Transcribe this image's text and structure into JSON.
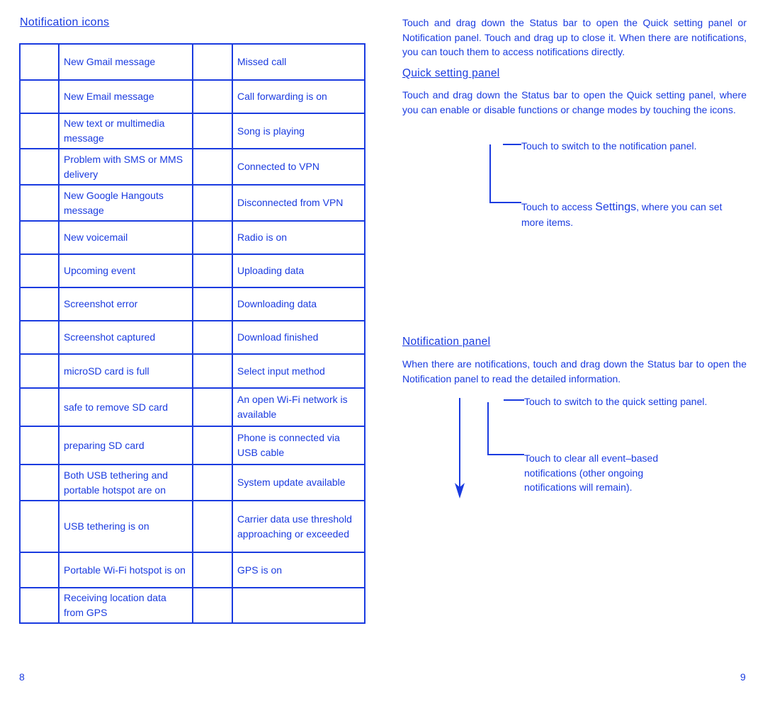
{
  "left_page": {
    "heading": "Notification icons",
    "rows": [
      {
        "left": "New Gmail message",
        "right": "Missed call"
      },
      {
        "left": "New Email message",
        "right": "Call forwarding is on"
      },
      {
        "left": "New text or multimedia message",
        "right": "Song is playing"
      },
      {
        "left": "Problem with SMS or MMS delivery",
        "right": "Connected to VPN"
      },
      {
        "left": "New Google Hangouts message",
        "right": "Disconnected from VPN"
      },
      {
        "left": "New voicemail",
        "right": "Radio is on"
      },
      {
        "left": "Upcoming event",
        "right": "Uploading data"
      },
      {
        "left": "Screenshot error",
        "right": "Downloading data"
      },
      {
        "left": "Screenshot captured",
        "right": "Download finished"
      },
      {
        "left": "microSD card is full",
        "right": "Select input method"
      },
      {
        "left": "safe to remove SD card",
        "right": "An open Wi-Fi network is available"
      },
      {
        "left": "preparing SD card",
        "right": "Phone is connected via USB cable"
      },
      {
        "left": "Both USB tethering and portable hotspot are on",
        "right": "System update available"
      },
      {
        "left": "USB tethering is on",
        "right": "Carrier data use threshold approaching or exceeded"
      },
      {
        "left": "Portable Wi-Fi hotspot is on",
        "right": "GPS is on"
      },
      {
        "left": "Receiving location data from GPS",
        "right": ""
      }
    ],
    "page_number": "8"
  },
  "right_page": {
    "intro": "Touch and drag down the Status bar to open the Quick setting panel or Notification panel. Touch and drag up to close it. When there are notifications, you can touch them to access notifications directly.",
    "quick_setting": {
      "heading": "Quick setting panel",
      "body": "Touch and drag down the Status bar to open the Quick setting panel, where you can enable or disable functions or change modes by touching the icons.",
      "callout_1": "Touch to switch to the notification panel.",
      "callout_2_prefix": "Touch to access ",
      "callout_2_keyword": "Settings",
      "callout_2_suffix": ", where you can set more items."
    },
    "notification_panel": {
      "heading": "Notification panel",
      "body": "When there are notifications, touch and drag down the Status bar to open the Notification panel to read the detailed information.",
      "callout_1": "Touch to switch to the quick setting panel.",
      "callout_2": "Touch to clear all event–based notifications (other ongoing notifications will remain)."
    },
    "page_number": "9"
  },
  "colors": {
    "text": "#1a3be0",
    "background": "#ffffff"
  }
}
